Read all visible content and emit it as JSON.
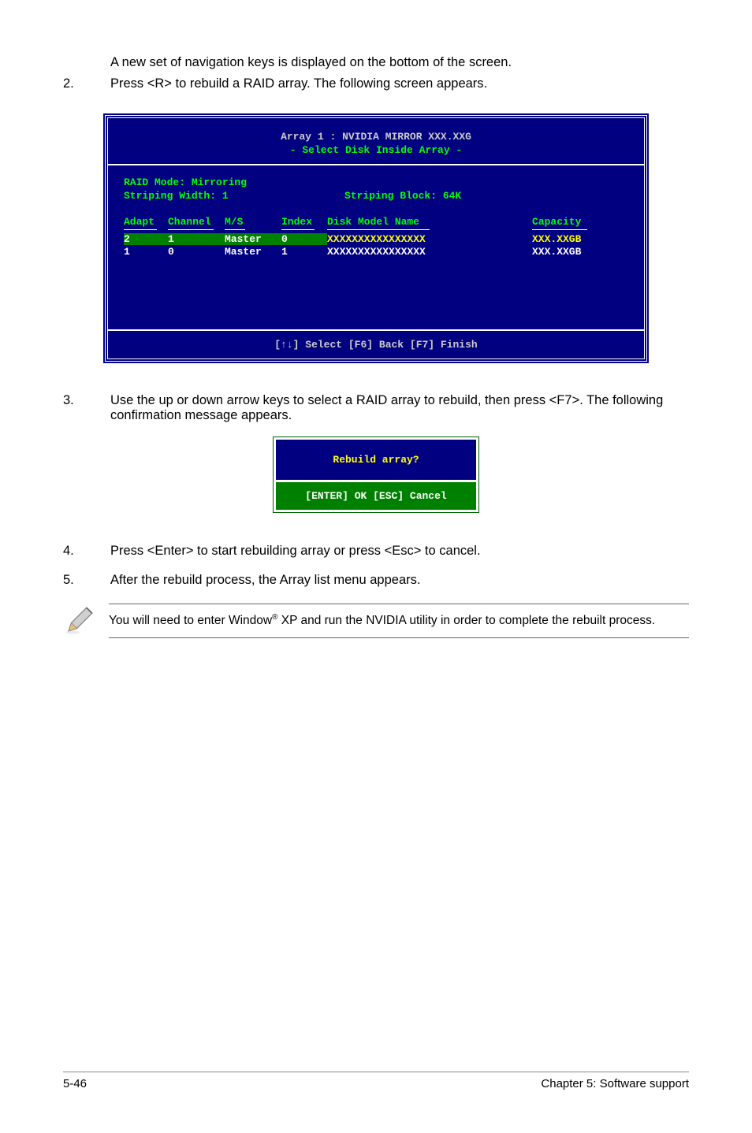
{
  "intro": "A new set of  navigation keys is displayed on the bottom of the screen.",
  "steps": {
    "s2": {
      "num": "2.",
      "text": "Press <R> to rebuild a RAID array. The following screen appears."
    },
    "s3": {
      "num": "3.",
      "text": "Use the up or down arrow keys to select a RAID array to rebuild, then press <F7>. The following confirmation message appears."
    },
    "s4": {
      "num": "4.",
      "text": "Press <Enter> to start rebuilding array or press <Esc> to cancel."
    },
    "s5": {
      "num": "5.",
      "text": "After the rebuild process, the Array list menu appears."
    }
  },
  "bios": {
    "header1": "Array 1 : NVIDIA MIRROR  XXX.XXG",
    "header2": "- Select Disk Inside Array -",
    "raidMode": "RAID Mode: Mirroring",
    "stripingWidth": "Striping Width: 1",
    "stripingBlock": "Striping Block: 64K",
    "th": {
      "adapt": "Adapt",
      "channel": "Channel",
      "ms": "M/S",
      "index": "Index",
      "model": "Disk Model Name",
      "capacity": "Capacity"
    },
    "rows": [
      {
        "adapt": "2",
        "channel": "1",
        "ms": "Master",
        "index": "0",
        "model": "XXXXXXXXXXXXXXXX",
        "capacity": "XXX.XXGB"
      },
      {
        "adapt": "1",
        "channel": "0",
        "ms": "Master",
        "index": "1",
        "model": "XXXXXXXXXXXXXXXX",
        "capacity": "XXX.XXGB"
      }
    ],
    "footer": "[↑↓] Select [F6] Back  [F7] Finish"
  },
  "dialog": {
    "title": "Rebuild array?",
    "buttons": "[ENTER] OK   [ESC] Cancel"
  },
  "note": {
    "text1": "You will need to enter Window",
    "sup": "®",
    "text2": " XP and run the NVIDIA utility in order to complete the rebuilt process."
  },
  "footer": {
    "left": "5-46",
    "right": "Chapter 5: Software support"
  }
}
